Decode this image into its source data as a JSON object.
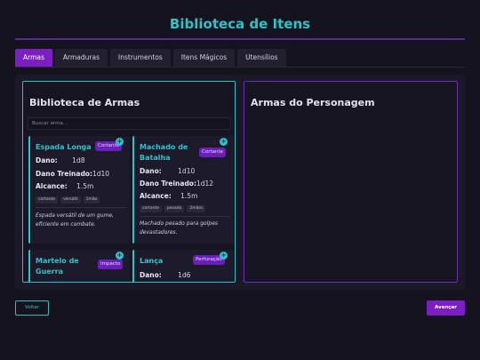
{
  "page": {
    "title": "Biblioteca de Itens"
  },
  "tabs": [
    {
      "label": "Armas",
      "active": true
    },
    {
      "label": "Armaduras",
      "active": false
    },
    {
      "label": "Instrumentos",
      "active": false
    },
    {
      "label": "Itens Mágicos",
      "active": false
    },
    {
      "label": "Utensílios",
      "active": false
    }
  ],
  "library": {
    "title": "Biblioteca de Armas",
    "search_placeholder": "Buscar arma...",
    "add_symbol": "+",
    "labels": {
      "damage": "Dano:",
      "trained_damage": "Dano Treinado:",
      "reach": "Alcance:"
    },
    "weapons": [
      {
        "name": "Espada Longa",
        "type": "Cortante",
        "damage": "1d8",
        "trained_damage": "1d10",
        "reach": "1.5m",
        "tags": [
          "cortante",
          "versátil",
          "1mão"
        ],
        "description": "Espada versátil de um gume, eficiente em combate."
      },
      {
        "name": "Machado de Batalha",
        "type": "Cortante",
        "damage": "1d10",
        "trained_damage": "1d12",
        "reach": "1.5m",
        "tags": [
          "cortante",
          "pesado",
          "2mãos"
        ],
        "description": "Machado pesado para golpes devastadores."
      },
      {
        "name": "Martelo de Guerra",
        "type": "Impacto"
      },
      {
        "name": "Lança",
        "type": "Perfuração",
        "damage": "1d6"
      }
    ]
  },
  "character": {
    "title": "Armas do Personagem"
  },
  "footer": {
    "back_label": "Voltar",
    "next_label": "Avançar"
  },
  "colors": {
    "accent": "#2fc3c9",
    "primary": "#7b1fc4",
    "background": "#15131e"
  }
}
